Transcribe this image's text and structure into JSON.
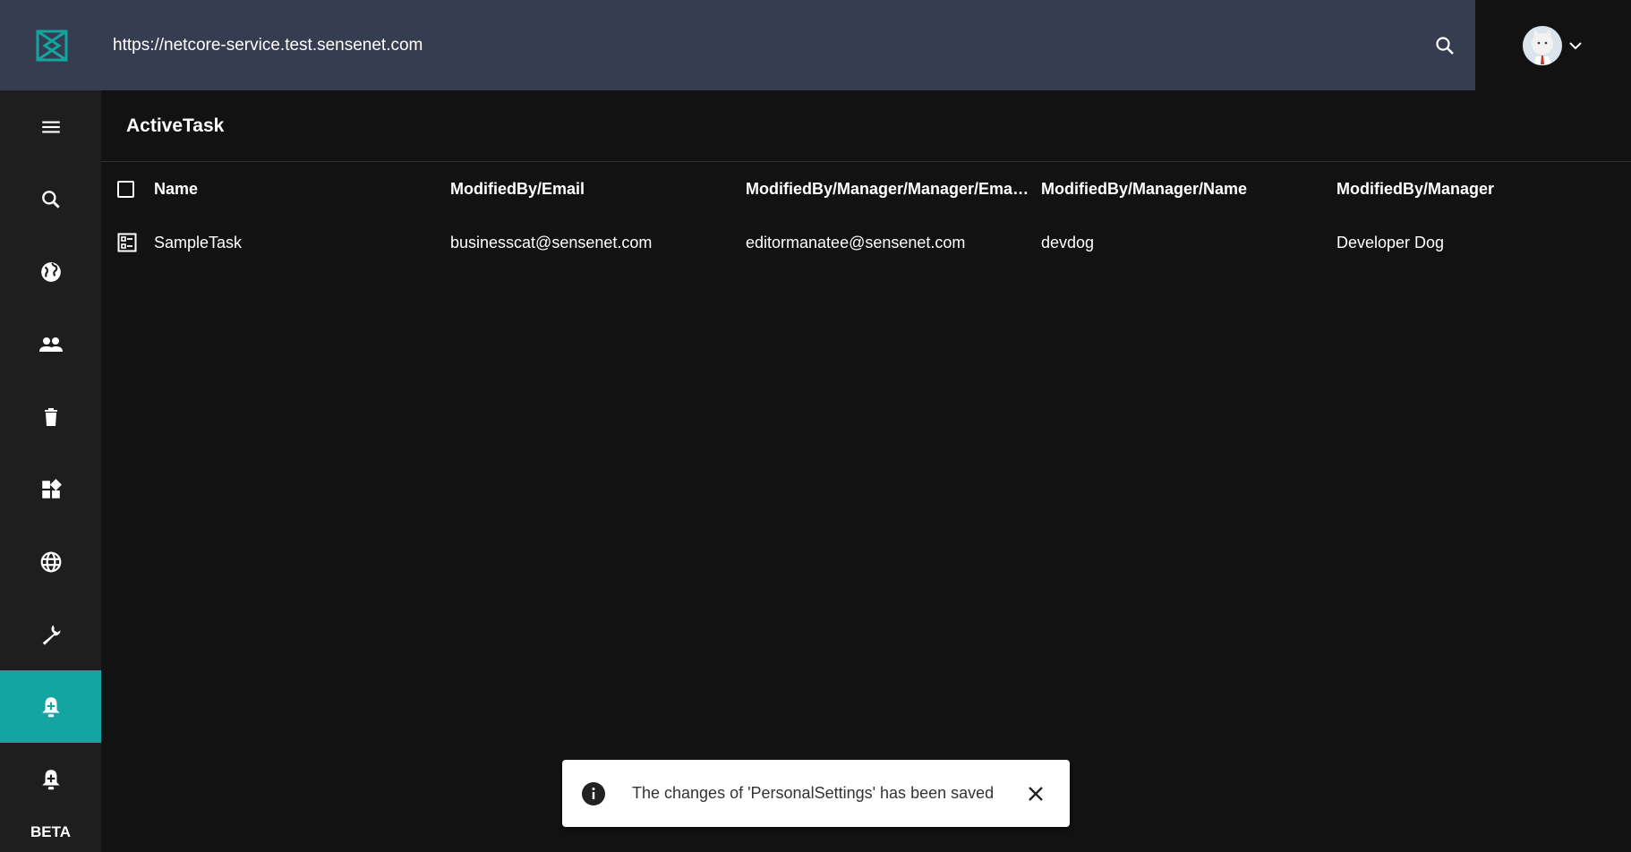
{
  "header": {
    "url": "https://netcore-service.test.sensenet.com",
    "logo_icon": "sensenet-logo",
    "search_icon": "search-icon",
    "brand_color": "#13a5a0",
    "bar_color": "#363d51"
  },
  "sidebar": {
    "items": [
      {
        "icon": "menu-icon"
      },
      {
        "icon": "search-icon"
      },
      {
        "icon": "public-icon"
      },
      {
        "icon": "users-icon"
      },
      {
        "icon": "trash-icon"
      },
      {
        "icon": "widgets-icon"
      },
      {
        "icon": "globe-icon"
      },
      {
        "icon": "wrench-icon"
      },
      {
        "icon": "notification-add-icon",
        "active": true
      },
      {
        "icon": "notification-add-icon"
      }
    ],
    "beta_label": "BETA"
  },
  "main": {
    "title": "ActiveTask",
    "columns": [
      "Name",
      "ModifiedBy/Email",
      "ModifiedBy/Manager/Manager/Email...",
      "ModifiedBy/Manager/Name",
      "ModifiedBy/Manager"
    ],
    "rows": [
      {
        "name": "SampleTask",
        "email": "businesscat@sensenet.com",
        "manager_manager_email": "editormanatee@sensenet.com",
        "manager_name": "devdog",
        "manager": "Developer Dog"
      }
    ]
  },
  "snackbar": {
    "message": "The changes of 'PersonalSettings' has been saved"
  }
}
